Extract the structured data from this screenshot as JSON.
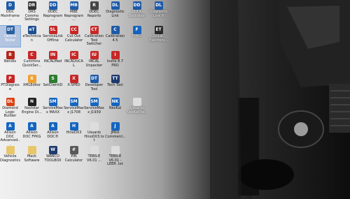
{
  "desktop": {
    "columns": [
      [
        {
          "label": "DDC Mainframe ...",
          "glyph": "D",
          "color": "#1e5aa8"
        },
        {
          "label": "Device Tester",
          "glyph": "DT",
          "color": "#2a5f9e",
          "selected": true
        },
        {
          "label": "Bendix",
          "glyph": "B",
          "color": "#b3261e"
        },
        {
          "label": "PTDiagnose",
          "glyph": "P",
          "color": "#c62828"
        },
        {
          "label": "Diamond Logic Builder",
          "glyph": "DL",
          "color": "#d84315"
        },
        {
          "label": "Allison DOC Advanced...",
          "glyph": "A",
          "color": "#1565c0"
        },
        {
          "label": "Vehicle Diagnostics",
          "glyph": "",
          "color": "#e8c66a"
        }
      ],
      [
        {
          "label": "DRS Commo Settings",
          "glyph": "DR",
          "color": "#333333"
        },
        {
          "label": "eTechnician",
          "glyph": "eT",
          "color": "#1e4f91"
        },
        {
          "label": "Cummins QuickSer...",
          "glyph": "C",
          "color": "#c62828"
        },
        {
          "label": "XMLEditor",
          "glyph": "X",
          "color": "#f0a030"
        },
        {
          "label": "Navistar Engine Di...",
          "glyph": "N",
          "color": "#212121"
        },
        {
          "label": "Allison DOC FPKG",
          "glyph": "A",
          "color": "#1565c0"
        },
        {
          "label": "Mack Software",
          "glyph": "",
          "color": "#e8c66a"
        }
      ],
      [
        {
          "label": "DDEC Reprogram...",
          "glyph": "DD",
          "color": "#1e5aa8"
        },
        {
          "label": "ServiceLink Offline",
          "glyph": "SL",
          "color": "#c62828"
        },
        {
          "label": "INCALMed",
          "glyph": "IN",
          "color": "#c62828"
        },
        {
          "label": "SetClientID",
          "glyph": "S",
          "color": "#2e7d32"
        },
        {
          "label": "ServiceMaxx MAXX",
          "glyph": "SM",
          "color": "#1565c0"
        },
        {
          "label": "Allison DOC®",
          "glyph": "A",
          "color": "#1565c0"
        },
        {
          "label": "WABCO TOOLBOX",
          "glyph": "W",
          "color": "#1e3a6e"
        }
      ],
      [
        {
          "label": "MBE Reprogram...",
          "glyph": "MB",
          "color": "#1e5aa8"
        },
        {
          "label": "Cut Out Calculator",
          "glyph": "CC",
          "color": "#c62828"
        },
        {
          "label": "INCALtoCAL",
          "glyph": "IC",
          "color": "#c62828"
        },
        {
          "label": "X-SPED",
          "glyph": "X",
          "color": "#c62828"
        },
        {
          "label": "ServiceMaxx J1708",
          "glyph": "SM",
          "color": "#1565c0"
        },
        {
          "label": "HinoDX3",
          "glyph": "H",
          "color": "#1565c0"
        },
        {
          "label": "PIN Calculator",
          "glyph": "#",
          "color": "#5a5a5a"
        }
      ],
      [
        {
          "label": "DDEC Reports",
          "glyph": "R",
          "color": "#444444"
        },
        {
          "label": "Calibration Tool Switcher",
          "glyph": "CT",
          "color": "#c62828"
        },
        {
          "label": "INCAL Unpacker ...",
          "glyph": "IU",
          "color": "#c62828"
        },
        {
          "label": "Developer Tool",
          "glyph": "DT",
          "color": "#1e5aa8"
        },
        {
          "label": "ServiceMaxx J1939",
          "glyph": "SM",
          "color": "#1565c0"
        },
        {
          "label": "Usuario HinoDX3.txt",
          "glyph": "",
          "color": "#dddddd"
        },
        {
          "label": "TEBS-E V6.01 ...",
          "glyph": "",
          "color": "#dddddd"
        }
      ],
      [
        {
          "label": "Diagnostic Link",
          "glyph": "DL",
          "color": "#1e5aa8"
        },
        {
          "label": "Calibration 4.5",
          "glyph": "C",
          "color": "#1e5aa8"
        },
        {
          "label": "Insite 8.7 PRO",
          "glyph": "I",
          "color": "#c62828"
        },
        {
          "label": "Tech Tool",
          "glyph": "TT",
          "color": "#1e3a6e"
        },
        {
          "label": "NexKal",
          "glyph": "NK",
          "color": "#1565c0"
        },
        {
          "label": "JPRO Commerci...",
          "glyph": "J",
          "color": "#1565c0"
        },
        {
          "label": "TEBS-E V6.01 - LEER .txt",
          "glyph": "",
          "color": "#dddddd"
        }
      ],
      [
        {
          "label": "DDDL Backdoor",
          "glyph": "DD",
          "color": "#1e5aa8"
        },
        {
          "label": "FPKG",
          "glyph": "F",
          "color": "#1565c0"
        },
        {
          "label": "",
          "glyph": "",
          "color": "transparent"
        },
        {
          "label": "",
          "glyph": "",
          "color": "transparent"
        },
        {
          "label": "Usuario NexKal_se...",
          "glyph": "",
          "color": "#dddddd"
        },
        {
          "label": "",
          "glyph": "",
          "color": "transparent"
        },
        {
          "label": "",
          "glyph": "",
          "color": "transparent"
        }
      ],
      [
        {
          "label": "Diagnostic Link 8",
          "glyph": "DL",
          "color": "#1e5aa8"
        },
        {
          "label": "2019C Electroni...",
          "glyph": "ET",
          "color": "#2b2b2b"
        },
        {
          "label": "",
          "glyph": "",
          "color": "transparent"
        },
        {
          "label": "",
          "glyph": "",
          "color": "transparent"
        },
        {
          "label": "",
          "glyph": "",
          "color": "transparent"
        },
        {
          "label": "",
          "glyph": "",
          "color": "transparent"
        },
        {
          "label": "",
          "glyph": "",
          "color": "transparent"
        }
      ]
    ]
  }
}
